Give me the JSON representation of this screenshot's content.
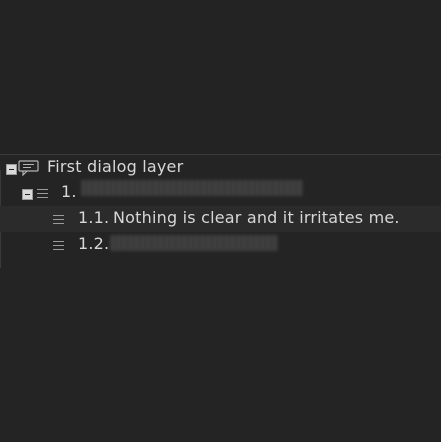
{
  "tree": {
    "root": {
      "label": "First dialog layer",
      "icon": "dialog-icon"
    },
    "items": [
      {
        "number": "1.",
        "text": ""
      },
      {
        "number": "1.1.",
        "text": "Nothing is clear and it irritates me."
      },
      {
        "number": "1.2.",
        "text": ""
      }
    ]
  },
  "colors": {
    "background": "#232323",
    "text": "#d7d7d7",
    "selected_row": "#2b2b2b"
  }
}
